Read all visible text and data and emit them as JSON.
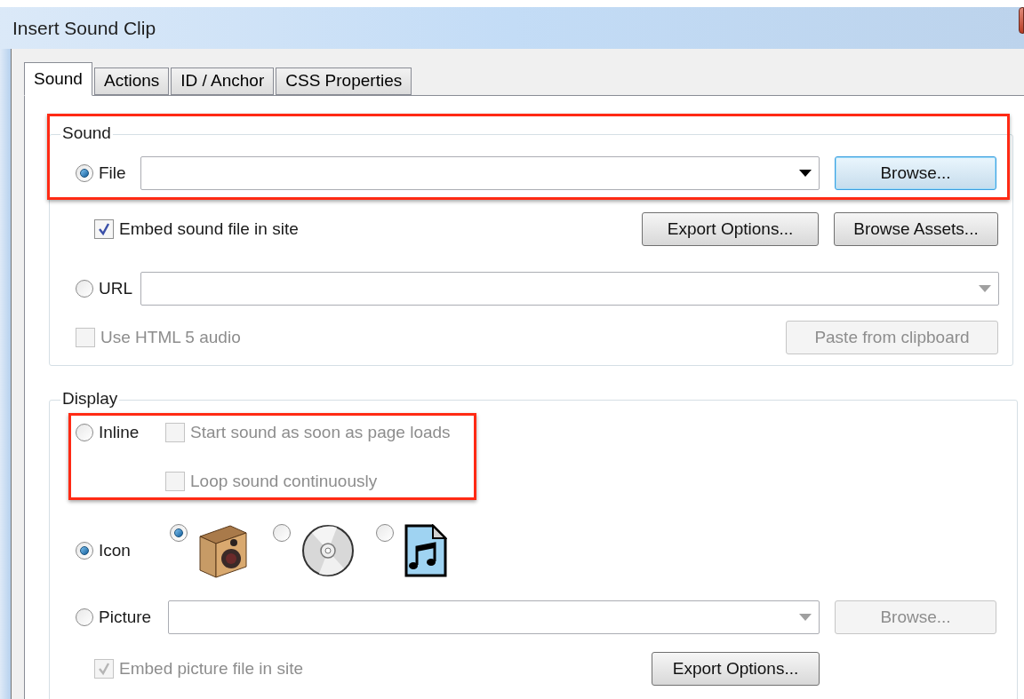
{
  "window": {
    "title": "Insert Sound Clip"
  },
  "tabs": [
    {
      "label": "Sound",
      "selected": true
    },
    {
      "label": "Actions",
      "selected": false
    },
    {
      "label": "ID / Anchor",
      "selected": false
    },
    {
      "label": "CSS Properties",
      "selected": false
    }
  ],
  "sound_group": {
    "legend": "Sound",
    "highlighted": true,
    "file": {
      "label": "File",
      "selected": true,
      "combo_disabled": false
    },
    "browse_button": {
      "label": "Browse...",
      "focused": true,
      "disabled": false
    },
    "embed": {
      "label": "Embed sound file in site",
      "checked": true,
      "disabled": false
    },
    "export_button": {
      "label": "Export Options...",
      "disabled": false
    },
    "assets_button": {
      "label": "Browse Assets...",
      "disabled": false
    },
    "url": {
      "label": "URL",
      "selected": false,
      "combo_disabled": true
    },
    "html5": {
      "label": "Use HTML 5 audio",
      "checked": false,
      "disabled": true
    },
    "paste_button": {
      "label": "Paste from clipboard",
      "disabled": true
    }
  },
  "display_group": {
    "legend": "Display",
    "inline": {
      "label": "Inline",
      "selected": false,
      "highlighted": true
    },
    "inline_options": [
      {
        "label": "Start sound as soon as page loads",
        "checked": false,
        "disabled": true
      },
      {
        "label": "Loop sound continuously",
        "checked": false,
        "disabled": true
      }
    ],
    "icon": {
      "label": "Icon",
      "selected": true
    },
    "icon_choices": [
      {
        "kind": "speaker",
        "selected": true
      },
      {
        "kind": "disc",
        "selected": false
      },
      {
        "kind": "music-file",
        "selected": false
      }
    ],
    "picture": {
      "label": "Picture",
      "selected": false,
      "combo_disabled": true
    },
    "picture_browse_button": {
      "label": "Browse...",
      "disabled": true
    },
    "embed_picture": {
      "label": "Embed picture file in site",
      "checked": true,
      "disabled": true
    },
    "picture_export_button": {
      "label": "Export Options...",
      "disabled": false
    }
  }
}
